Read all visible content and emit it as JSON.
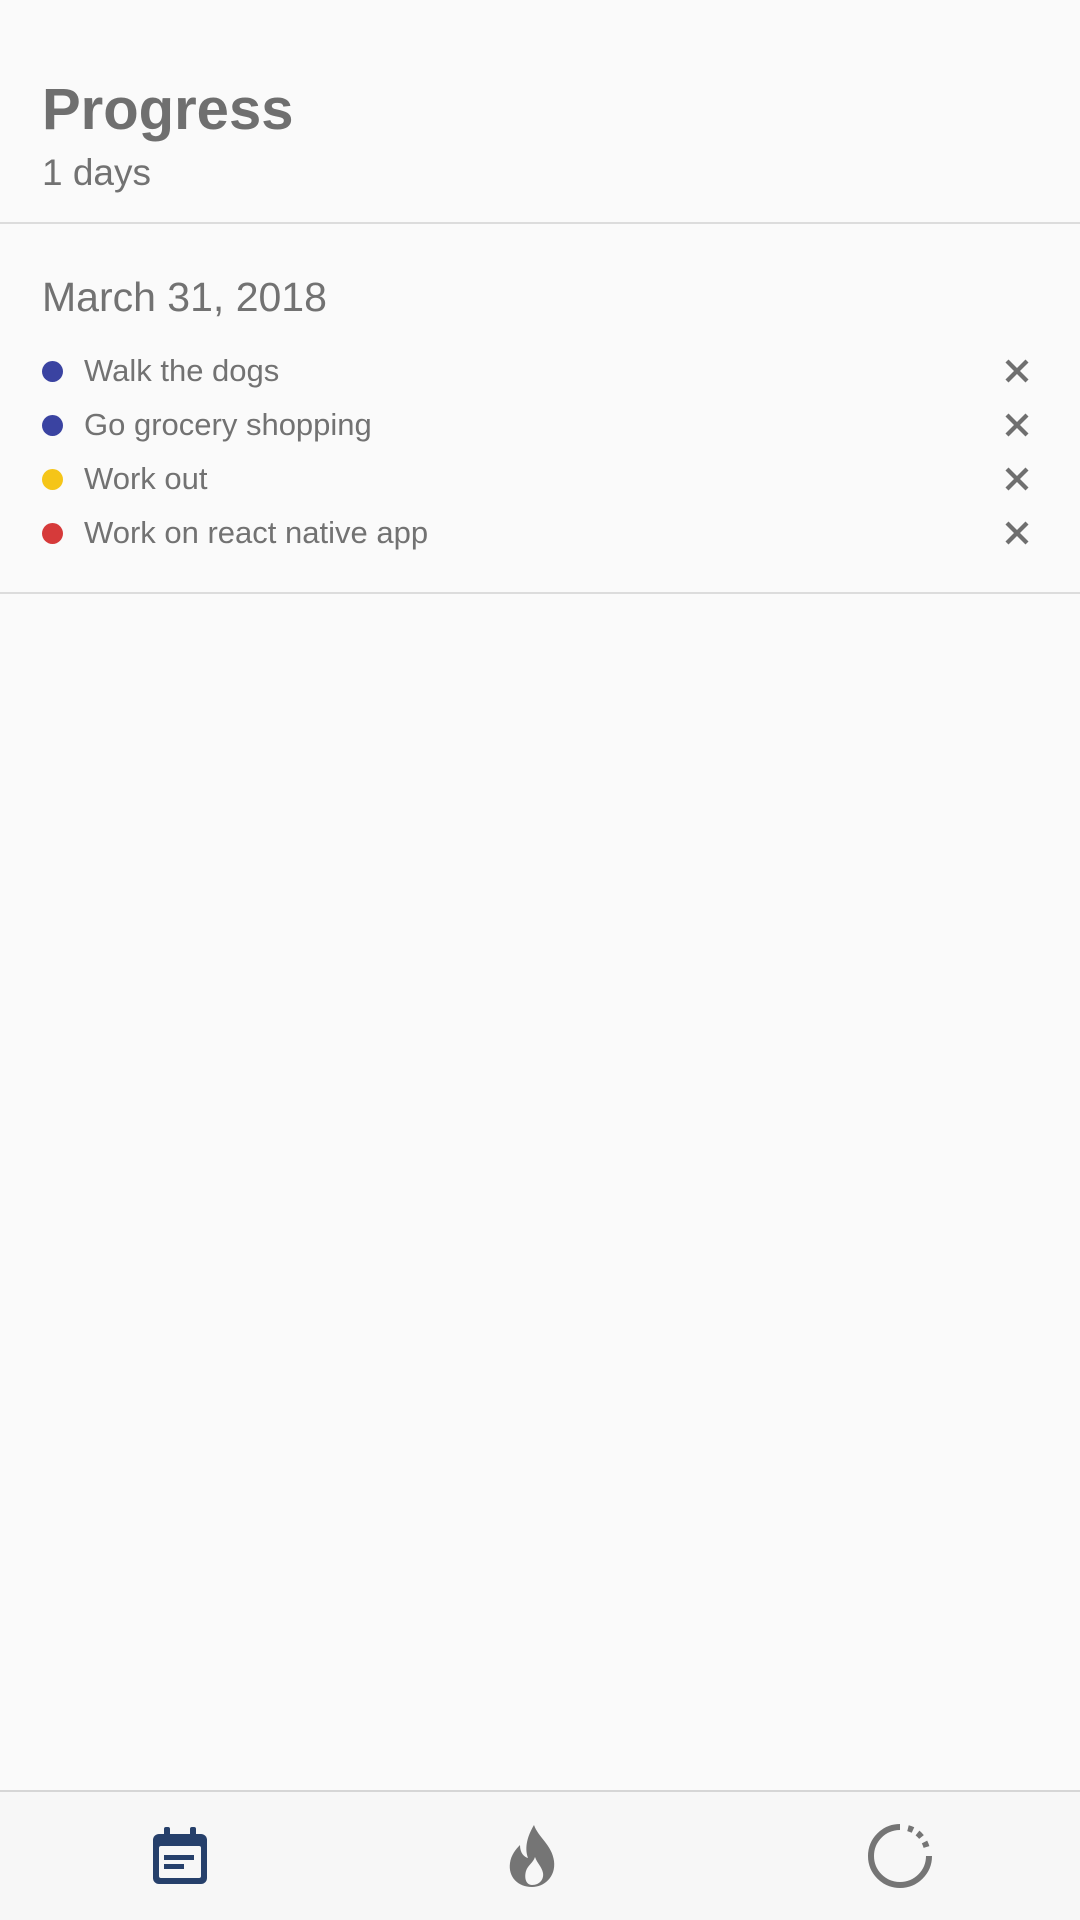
{
  "header": {
    "title": "Progress",
    "subtitle": "1 days"
  },
  "day": {
    "date": "March 31, 2018",
    "tasks": [
      {
        "label": "Walk the dogs",
        "color": "#3a43a1"
      },
      {
        "label": "Go grocery shopping",
        "color": "#3a43a1"
      },
      {
        "label": "Work out",
        "color": "#f5c518"
      },
      {
        "label": "Work on react native app",
        "color": "#d63a3a"
      }
    ]
  },
  "bottom_nav": {
    "items": [
      {
        "icon": "calendar-icon",
        "active": true
      },
      {
        "icon": "fire-icon",
        "active": false
      },
      {
        "icon": "progress-circle-icon",
        "active": false
      }
    ],
    "active_color": "#26406b",
    "inactive_color": "#757575"
  }
}
